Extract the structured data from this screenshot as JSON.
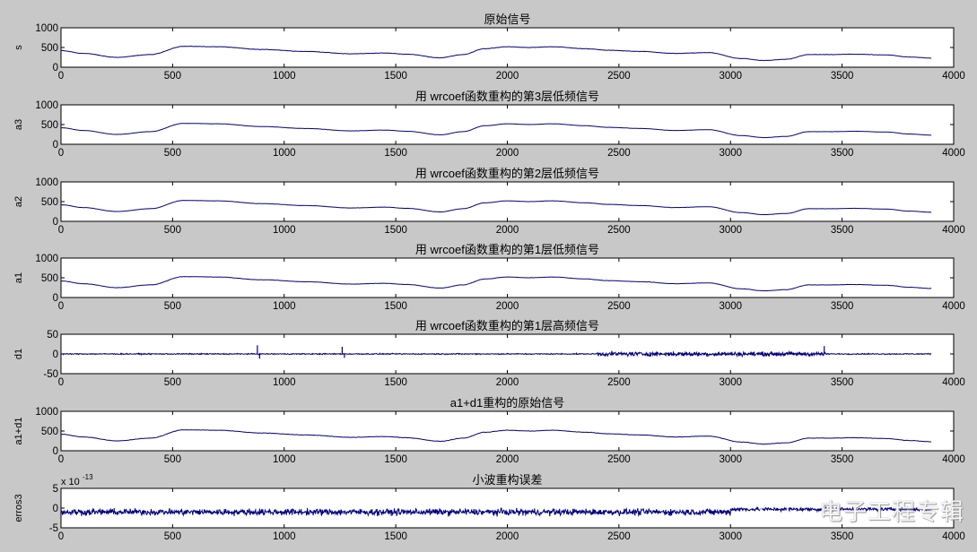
{
  "chart_data": [
    {
      "type": "line",
      "title": "原始信号",
      "ylabel": "s",
      "xlim": [
        0,
        4000
      ],
      "ylim": [
        0,
        1000
      ],
      "xticks": [
        0,
        500,
        1000,
        1500,
        2000,
        2500,
        3000,
        3500,
        4000
      ],
      "yticks": [
        0,
        500,
        1000
      ],
      "series": [
        {
          "color": "#000080",
          "kind": "smooth",
          "noise": 8,
          "x": [
            0,
            100,
            250,
            400,
            550,
            700,
            900,
            1100,
            1300,
            1450,
            1550,
            1700,
            1800,
            1900,
            2000,
            2100,
            2200,
            2350,
            2450,
            2600,
            2750,
            2900,
            3050,
            3150,
            3250,
            3350,
            3450,
            3550,
            3700,
            3800,
            3900
          ],
          "y": [
            420,
            350,
            250,
            320,
            530,
            520,
            450,
            400,
            340,
            360,
            330,
            240,
            320,
            470,
            520,
            500,
            520,
            470,
            430,
            400,
            350,
            370,
            220,
            170,
            200,
            320,
            320,
            330,
            310,
            260,
            230
          ]
        }
      ]
    },
    {
      "type": "line",
      "title": "用 wrcoef函数重构的第3层低频信号",
      "ylabel": "a3",
      "xlim": [
        0,
        4000
      ],
      "ylim": [
        0,
        1000
      ],
      "xticks": [
        0,
        500,
        1000,
        1500,
        2000,
        2500,
        3000,
        3500,
        4000
      ],
      "yticks": [
        0,
        500,
        1000
      ],
      "series": [
        {
          "color": "#000080",
          "kind": "smooth",
          "noise": 3,
          "x": [
            0,
            100,
            250,
            400,
            550,
            700,
            900,
            1100,
            1300,
            1450,
            1550,
            1700,
            1800,
            1900,
            2000,
            2100,
            2200,
            2350,
            2450,
            2600,
            2750,
            2900,
            3050,
            3150,
            3250,
            3350,
            3450,
            3550,
            3700,
            3800,
            3900
          ],
          "y": [
            420,
            350,
            250,
            320,
            530,
            520,
            450,
            400,
            340,
            360,
            330,
            240,
            320,
            470,
            520,
            500,
            520,
            470,
            430,
            400,
            350,
            370,
            220,
            170,
            200,
            320,
            320,
            330,
            310,
            260,
            230
          ]
        }
      ]
    },
    {
      "type": "line",
      "title": "用 wrcoef函数重构的第2层低频信号",
      "ylabel": "a2",
      "xlim": [
        0,
        4000
      ],
      "ylim": [
        0,
        1000
      ],
      "xticks": [
        0,
        500,
        1000,
        1500,
        2000,
        2500,
        3000,
        3500,
        4000
      ],
      "yticks": [
        0,
        500,
        1000
      ],
      "series": [
        {
          "color": "#000080",
          "kind": "smooth",
          "noise": 4,
          "x": [
            0,
            100,
            250,
            400,
            550,
            700,
            900,
            1100,
            1300,
            1450,
            1550,
            1700,
            1800,
            1900,
            2000,
            2100,
            2200,
            2350,
            2450,
            2600,
            2750,
            2900,
            3050,
            3150,
            3250,
            3350,
            3450,
            3550,
            3700,
            3800,
            3900
          ],
          "y": [
            420,
            350,
            250,
            320,
            530,
            520,
            450,
            400,
            340,
            360,
            330,
            240,
            320,
            470,
            520,
            500,
            520,
            470,
            430,
            400,
            350,
            370,
            220,
            170,
            200,
            320,
            320,
            330,
            310,
            260,
            230
          ]
        }
      ]
    },
    {
      "type": "line",
      "title": "用 wrcoef函数重构的第1层低频信号",
      "ylabel": "a1",
      "xlim": [
        0,
        4000
      ],
      "ylim": [
        0,
        1000
      ],
      "xticks": [
        0,
        500,
        1000,
        1500,
        2000,
        2500,
        3000,
        3500,
        4000
      ],
      "yticks": [
        0,
        500,
        1000
      ],
      "series": [
        {
          "color": "#000080",
          "kind": "smooth",
          "noise": 6,
          "x": [
            0,
            100,
            250,
            400,
            550,
            700,
            900,
            1100,
            1300,
            1450,
            1550,
            1700,
            1800,
            1900,
            2000,
            2100,
            2200,
            2350,
            2450,
            2600,
            2750,
            2900,
            3050,
            3150,
            3250,
            3350,
            3450,
            3550,
            3700,
            3800,
            3900
          ],
          "y": [
            420,
            350,
            250,
            320,
            530,
            520,
            450,
            400,
            340,
            360,
            330,
            240,
            320,
            470,
            520,
            500,
            520,
            470,
            430,
            400,
            350,
            370,
            220,
            170,
            200,
            320,
            320,
            330,
            310,
            260,
            230
          ]
        }
      ]
    },
    {
      "type": "line",
      "title": "用 wrcoef函数重构的第1层高频信号",
      "ylabel": "d1",
      "xlim": [
        0,
        4000
      ],
      "ylim": [
        -50,
        50
      ],
      "xticks": [
        0,
        500,
        1000,
        1500,
        2000,
        2500,
        3000,
        3500,
        4000
      ],
      "yticks": [
        -50,
        0,
        50
      ],
      "series": [
        {
          "color": "#000080",
          "kind": "noise",
          "segments": [
            {
              "from": 0,
              "to": 2400,
              "amp": 2
            },
            {
              "from": 2400,
              "to": 3430,
              "amp": 8
            },
            {
              "from": 3430,
              "to": 3900,
              "amp": 2
            }
          ],
          "spikes": [
            {
              "x": 880,
              "y": 22
            },
            {
              "x": 890,
              "y": -12
            },
            {
              "x": 1260,
              "y": 18
            },
            {
              "x": 1270,
              "y": -10
            },
            {
              "x": 3420,
              "y": 20
            }
          ]
        }
      ]
    },
    {
      "type": "line",
      "title": "a1+d1重构的原始信号",
      "ylabel": "a1+d1",
      "xlim": [
        0,
        4000
      ],
      "ylim": [
        0,
        1000
      ],
      "xticks": [
        0,
        500,
        1000,
        1500,
        2000,
        2500,
        3000,
        3500,
        4000
      ],
      "yticks": [
        0,
        500,
        1000
      ],
      "series": [
        {
          "color": "#000080",
          "kind": "smooth",
          "noise": 8,
          "x": [
            0,
            100,
            250,
            400,
            550,
            700,
            900,
            1100,
            1300,
            1450,
            1550,
            1700,
            1800,
            1900,
            2000,
            2100,
            2200,
            2350,
            2450,
            2600,
            2750,
            2900,
            3050,
            3150,
            3250,
            3350,
            3450,
            3550,
            3700,
            3800,
            3900
          ],
          "y": [
            420,
            350,
            250,
            320,
            530,
            520,
            450,
            400,
            340,
            360,
            330,
            240,
            320,
            470,
            520,
            500,
            520,
            470,
            430,
            400,
            350,
            370,
            220,
            170,
            200,
            320,
            320,
            330,
            310,
            260,
            230
          ]
        }
      ]
    },
    {
      "type": "line",
      "title": "小波重构误差",
      "ylabel": "erros3",
      "exponent_label": "x 10",
      "exponent_power": "-13",
      "xlim": [
        0,
        4000
      ],
      "ylim": [
        -5,
        5
      ],
      "xticks": [
        0,
        500,
        1000,
        1500,
        2000,
        2500,
        3000,
        3500,
        4000
      ],
      "yticks": [
        -5,
        0,
        5
      ],
      "series": [
        {
          "color": "#000080",
          "kind": "noise",
          "segments": [
            {
              "from": 0,
              "to": 3000,
              "amp": 1.2,
              "offset": -1.0
            },
            {
              "from": 3000,
              "to": 3900,
              "amp": 0.7,
              "offset": -0.3
            }
          ]
        }
      ]
    }
  ],
  "watermark": {
    "text": "电子工程专辑"
  }
}
